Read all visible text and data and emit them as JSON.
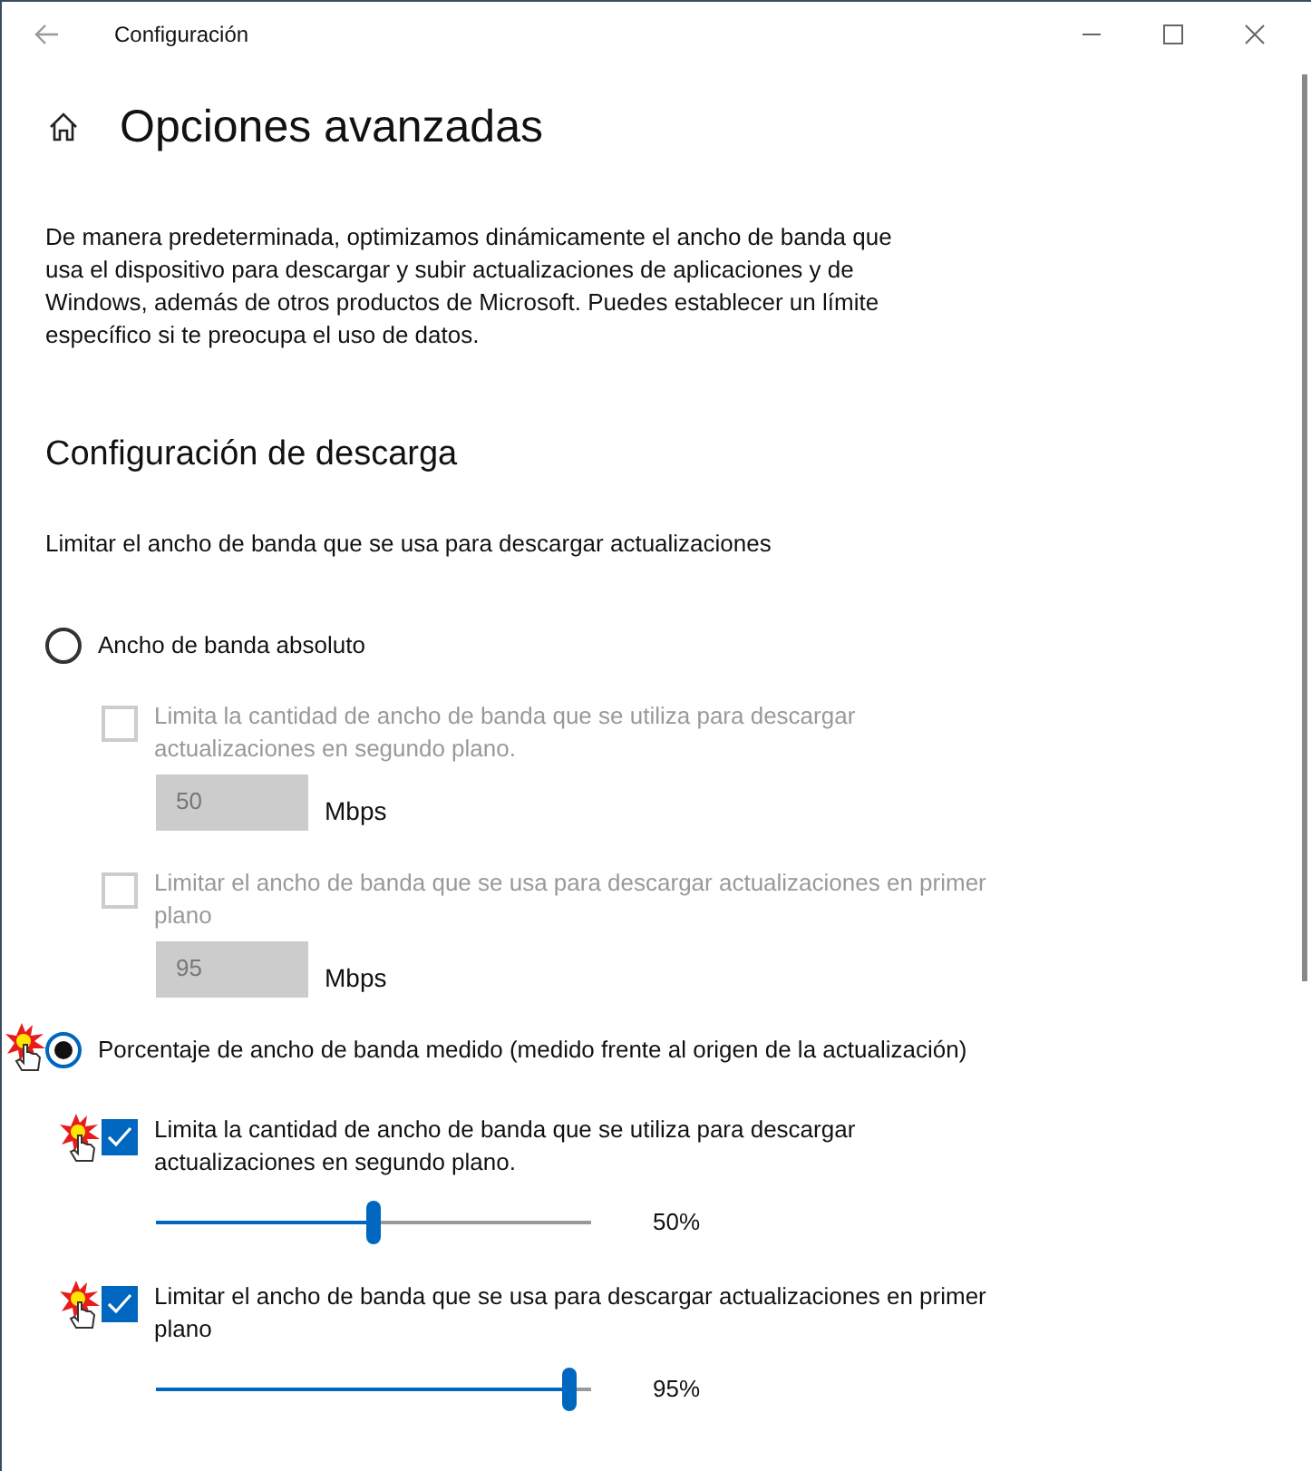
{
  "window": {
    "title": "Configuración"
  },
  "page": {
    "title": "Opciones avanzadas",
    "description": "De manera predeterminada, optimizamos dinámicamente el ancho de banda que usa el dispositivo para descargar y subir actualizaciones de aplicaciones y de Windows, además de otros productos de Microsoft. Puedes establecer un límite específico si te preocupa el uso de datos."
  },
  "section": {
    "title": "Configuración de descarga",
    "subtitle": "Limitar el ancho de banda que se usa para descargar actualizaciones"
  },
  "options": [
    {
      "label": "Ancho de banda absoluto",
      "selected": false,
      "clicked": false,
      "limits": [
        {
          "kind": "field",
          "label": "Limita la cantidad de ancho de banda que se utiliza para descargar actualizaciones en segundo plano.",
          "checked": false,
          "disabled": true,
          "clicked": false,
          "value": "50",
          "unit": "Mbps"
        },
        {
          "kind": "field",
          "label": "Limitar el ancho de banda que se usa para descargar actualizaciones en primer plano",
          "checked": false,
          "disabled": true,
          "clicked": false,
          "value": "95",
          "unit": "Mbps"
        }
      ]
    },
    {
      "label": "Porcentaje de ancho de banda medido (medido frente al origen de la actualización)",
      "selected": true,
      "clicked": true,
      "limits": [
        {
          "kind": "slider",
          "label": "Limita la cantidad de ancho de banda que se utiliza para descargar actualizaciones en segundo plano.",
          "checked": true,
          "disabled": false,
          "clicked": true,
          "level": 0.5,
          "reading": "50%"
        },
        {
          "kind": "slider",
          "label": "Limitar el ancho de banda que se usa para descargar actualizaciones en primer plano",
          "checked": true,
          "disabled": false,
          "clicked": true,
          "level": 0.95,
          "reading": "95%"
        }
      ]
    }
  ]
}
